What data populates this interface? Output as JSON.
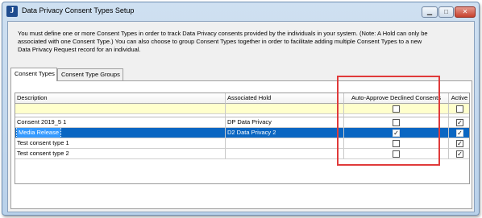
{
  "window": {
    "title": "Data Privacy Consent Types Setup",
    "icon_glyph": "J",
    "controls": {
      "minimize": "▁",
      "maximize": "□",
      "close": "✕"
    }
  },
  "description": "You must define one or more Consent Types in order to track Data Privacy consents provided by the individuals in your system.  (Note: A Hold can only be associated with one Consent Type.) You can also choose to group Consent Types together in order to facilitate adding multiple Consent Types to a new Data Privacy Request record for an individual.",
  "tabs": [
    {
      "label": "Consent Types",
      "active": true
    },
    {
      "label": "Consent Type Groups",
      "active": false
    }
  ],
  "grid": {
    "columns": [
      "Description",
      "Associated Hold",
      "Auto-Approve Declined Consents",
      "Active"
    ],
    "rows": [
      {
        "description": "Consent 2019_5 1",
        "hold": "DP   Data Privacy",
        "auto_approve": "",
        "active": "✓",
        "selected": false
      },
      {
        "description": "Media Release",
        "hold": "D2   Data Privacy 2",
        "auto_approve": "✓",
        "active": "✓",
        "selected": true
      },
      {
        "description": "Test consent type 1",
        "hold": "",
        "auto_approve": "",
        "active": "✓",
        "selected": false
      },
      {
        "description": "Test consent type 2",
        "hold": "",
        "auto_approve": "",
        "active": "✓",
        "selected": false
      }
    ]
  },
  "colors": {
    "selection": "#0a66c2",
    "filter_row": "#ffffcc",
    "annotation_box": "#e03a3a"
  }
}
